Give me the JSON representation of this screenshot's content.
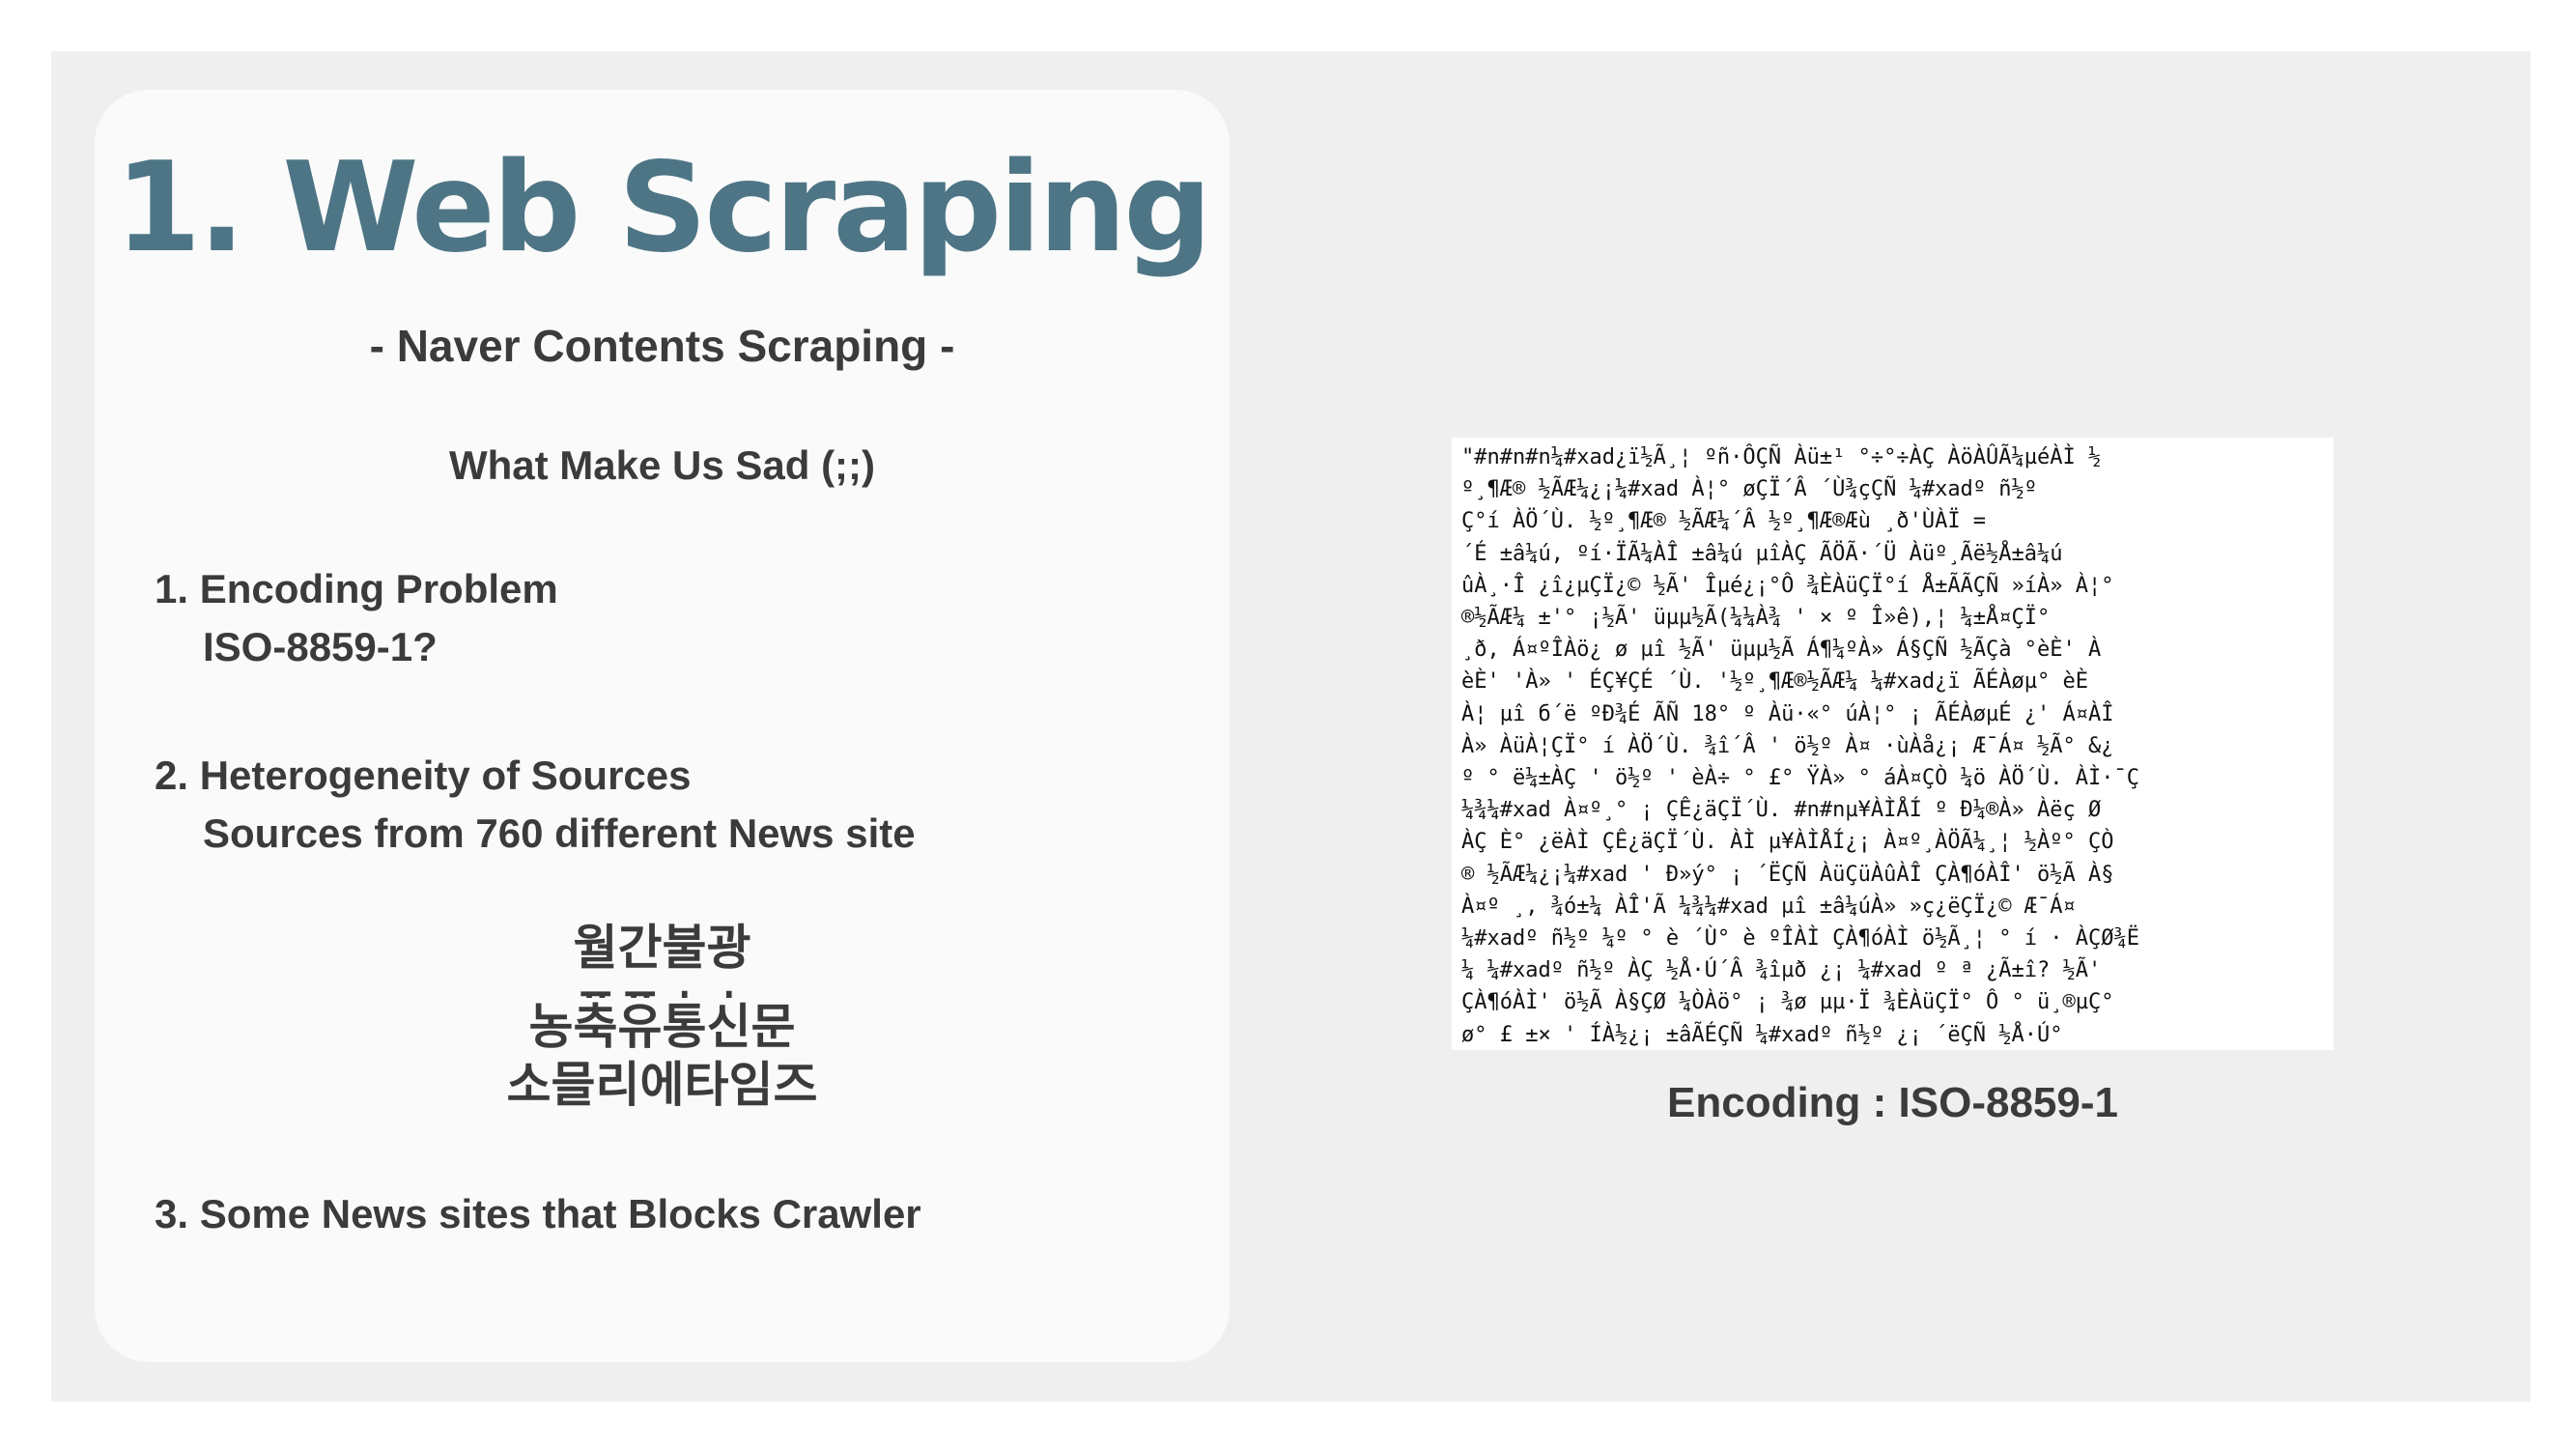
{
  "title": "1. Web Scraping",
  "subtitle": "- Naver Contents Scraping -",
  "sad_heading": "What Make Us Sad  (;;)",
  "items": [
    {
      "title": "1. Encoding Problem",
      "detail": "ISO-8859-1?"
    },
    {
      "title": "2. Heterogeneity of Sources",
      "detail": "Sources from 760 different News site"
    },
    {
      "title": "3. Some News sites that Blocks Crawler",
      "detail": ""
    }
  ],
  "korean_sites": [
    "월간불광",
    "ㅍㅍㅅㅅ",
    "농축유통신문",
    "소믈리에타임즈"
  ],
  "garbled_lines": [
    "\"#n#n#n¼#xad¿ï½Ã¸¦ ºñ·ÔÇÑ Àü±¹ °÷°÷ÀÇ ÀöÀÛÃ¼µéÀÌ ½",
    "º¸¶Æ® ½ÃÆ¼¿¡¼#xad À¦° øÇÏ´Â ´Ù¾çÇÑ ¼#xadº ñ½º",
    "Ç°í ÀÖ´Ù. ½º¸¶Æ® ½ÃÆ¼´Â ½º¸¶Æ®Æù ¸ð'ÙÀÏ =",
    "´É ±â¼ú, ºí·ÏÃ¼ÀÎ ±â¼ú µîÀÇ ÃÖÃ·´Ü Àüº¸Ãë½Å±â¼ú",
    "ûÀ¸·Î ¿î¿µÇÏ¿© ½Ã' Îµé¿¡°Ô ¾ÈÀüÇÏ°í Å±ÃÃÇÑ »íÀ» À¦°",
    "®½ÃÆ¼ ±'° ¡½Ã' üµµ½Ã(¼¼À¾ ' × º Î»ê),¦ ¼±Å¤ÇÏ°",
    "¸ð, Á¤ºÎÀö¿ ø µî ½Ã' üµµ½Ã Á¶¼ºÀ» Á§ÇÑ ½ÃÇà °èÈ' À",
    "èÈ' 'À» ' ÉÇ¥ÇÉ ´Ù. '½º¸¶Æ®½ÃÆ¼ ¼#xad¿ï ÃÉÀøµ° èÈ",
    "À¦ µî б´ë ºÐ¾É ÃÑ 18° º Àü·«° úÀ¦° ¡ ÃÉÀøµÉ ¿' Á¤ÀÎ",
    "À» ÀüÀ¦ÇÏ° í ÀÖ´Ù. ¾î´Â ' ö½º À¤ ·ùÀå¿¡ Æ¯Á¤ ½Ã° &¿",
    "º ° ë¼±ÀÇ ' ö½º ' èÀ÷ ° £° ŸÀ» ° áÀ¤ÇÒ ¼ö ÀÖ´Ù. ÀÌ·¯Ç",
    "¼¾¼#xad À¤º¸° ¡ ÇÊ¿äÇÏ´Ù. #n#nµ¥ÀÌÅÍ º Ð¼®À» Àëç Ø",
    "ÀÇ È° ¿ëÀÌ ÇÊ¿äÇÏ´Ù. ÀÌ µ¥ÀÌÅÍ¿¡ À¤º¸ÀÖÃ¼¸¦ ½Àº° ÇÒ",
    "® ½ÃÆ¼¿¡¼#xad ' Ð»ý° ¡ ´ËÇÑ ÀüÇüÀûÀÎ ÇÀ¶óÀÎ' ö½Ã À§",
    "À¤º ¸, ¾ó±¼ ÀÎ'Ã ¼¾¼#xad µî ±â¼úÀ» »ç¿ëÇÏ¿© Æ¯Á¤",
    "¼#xadº ñ½º ¼º ° è ´Ù° è ºÎÀÌ ÇÀ¶óÀÌ ö½Ã¸¦ ° í · ÀÇØ¾Ë",
    "¼ ¼#xadº ñ½º ÀÇ ½Å·Ú´Â ¾îµð ¿¡ ¼#xad º ª ¿Ã±î? ½Ã'",
    "ÇÀ¶óÀÌ' ö½Ã À§ÇØ ¼ÒÀö° ¡ ¾ø µµ·Ï ¾ÈÀüÇÏ° Ô ° ü¸®µÇ°",
    "ø° £ ±× ' ÍÀ½¿¡ ±âÃÉÇÑ ¼#xadº ñ½º ¿¡ ´ëÇÑ ½Å·Ú°"
  ],
  "caption": "Encoding : ISO-8859-1"
}
